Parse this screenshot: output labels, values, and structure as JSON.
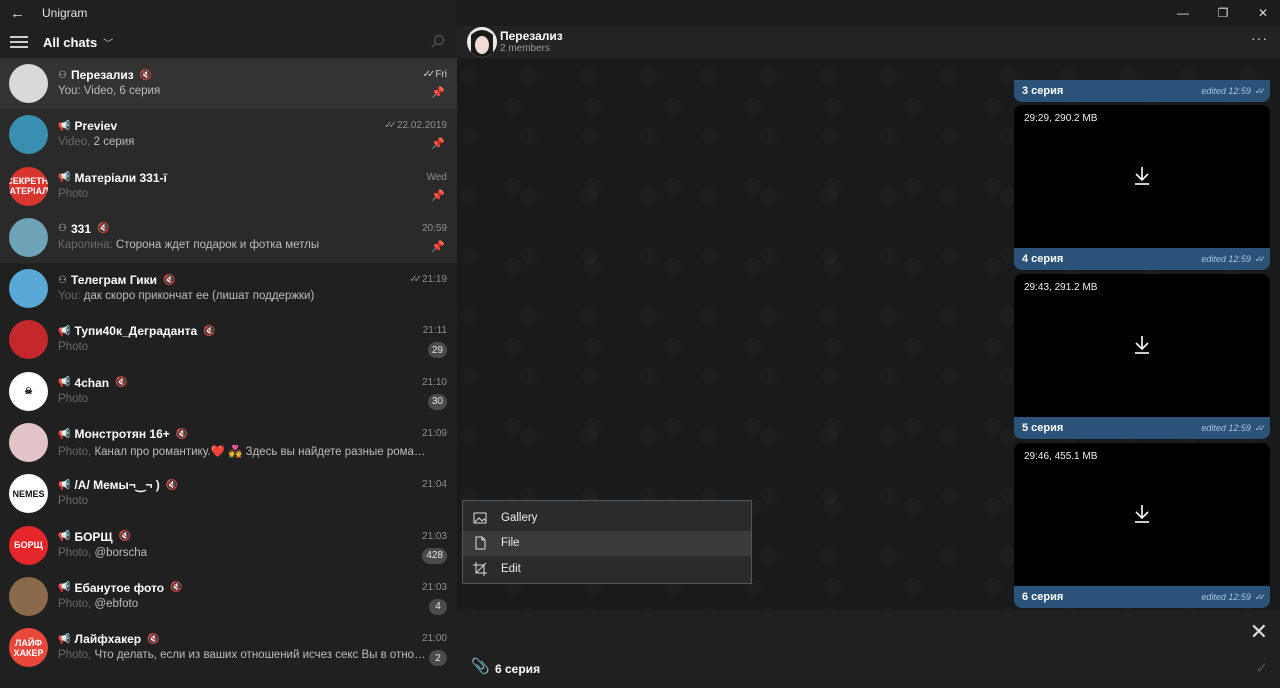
{
  "app": {
    "title": "Unigram"
  },
  "left": {
    "filter_label": "All chats",
    "chats": [
      {
        "name": "Перезализ",
        "preview_prefix": "",
        "preview": "You: Video, 6 серия",
        "time": "Fri",
        "read": true,
        "pinned": true,
        "muted": true,
        "type": "group",
        "badge": "",
        "avatar_color": "#d9d9d9",
        "avatar_text": ""
      },
      {
        "name": "Previev",
        "preview_prefix": "Video, ",
        "preview": "2 серия",
        "time": "22.02.2019",
        "read": true,
        "pinned": true,
        "muted": false,
        "type": "channel",
        "badge": "",
        "avatar_color": "#3a8fb0",
        "avatar_text": ""
      },
      {
        "name": "Матеріали 331-ї",
        "preview_prefix": "Photo",
        "preview": "",
        "time": "Wed",
        "read": false,
        "pinned": true,
        "muted": false,
        "type": "channel",
        "badge": "",
        "avatar_color": "#d8352f",
        "avatar_text": "СЕКРЕТНІ МАТЕРІАЛИ"
      },
      {
        "name": "331",
        "preview_prefix": "Каролина: ",
        "preview": "Сторона ждет подарок и фотка метлы",
        "time": "20:59",
        "read": false,
        "pinned": true,
        "muted": true,
        "type": "group",
        "badge": "",
        "avatar_color": "#6fa3b8",
        "avatar_text": ""
      },
      {
        "name": "Телеграм Гики",
        "preview_prefix": "You: ",
        "preview": "дак скоро прикончат ее (лишат поддержки)",
        "time": "21:19",
        "read": true,
        "pinned": false,
        "muted": true,
        "type": "group",
        "badge": "",
        "avatar_color": "#5aa8d6",
        "avatar_text": ""
      },
      {
        "name": "Тупи40к_Деграданта",
        "preview_prefix": "Photo",
        "preview": "",
        "time": "21:11",
        "read": false,
        "pinned": false,
        "muted": true,
        "type": "channel",
        "badge": "29",
        "avatar_color": "#c4282c",
        "avatar_text": ""
      },
      {
        "name": "4chan",
        "preview_prefix": "Photo",
        "preview": "",
        "time": "21:10",
        "read": false,
        "pinned": false,
        "muted": true,
        "type": "channel",
        "badge": "30",
        "avatar_color": "#ffffff",
        "avatar_text": "☠"
      },
      {
        "name": "Монстротян 16+",
        "preview_prefix": "Photo, ",
        "preview": "Канал про романтику.❤️ 💑 Здесь вы найдете разные романтичес...",
        "time": "21:09",
        "read": false,
        "pinned": false,
        "muted": true,
        "type": "channel",
        "badge": "",
        "avatar_color": "#e2c4c8",
        "avatar_text": ""
      },
      {
        "name": "/A/ Мемы¬‿¬ )",
        "preview_prefix": "Photo",
        "preview": "",
        "time": "21:04",
        "read": false,
        "pinned": false,
        "muted": true,
        "type": "channel",
        "badge": "",
        "avatar_color": "#ffffff",
        "avatar_text": "NEMES"
      },
      {
        "name": "БОРЩ",
        "preview_prefix": "Photo, ",
        "preview": "@borscha",
        "time": "21:03",
        "read": false,
        "pinned": false,
        "muted": true,
        "type": "channel",
        "badge": "428",
        "avatar_color": "#e5262a",
        "avatar_text": "БОРЩ"
      },
      {
        "name": "Ебанутое фото",
        "preview_prefix": "Photo, ",
        "preview": "@ebfoto",
        "time": "21:03",
        "read": false,
        "pinned": false,
        "muted": true,
        "type": "channel",
        "badge": "4",
        "avatar_color": "#8a6a4a",
        "avatar_text": ""
      },
      {
        "name": "Лайфхакер",
        "preview_prefix": "Photo, ",
        "preview": "Что делать, если из ваших отношений исчез секс  Вы в отноше...",
        "time": "21:00",
        "read": false,
        "pinned": false,
        "muted": true,
        "type": "channel",
        "badge": "2",
        "avatar_color": "#e8483c",
        "avatar_text": "ЛАЙФ ХАКЕР"
      }
    ]
  },
  "right": {
    "chat_title": "Перезализ",
    "chat_subtitle": "2 members",
    "videos": [
      {
        "caption": "3 серия",
        "info": "",
        "edited": "edited",
        "time": "12:59"
      },
      {
        "caption": "4 серия",
        "info": "29:29, 290.2 MB",
        "edited": "edited",
        "time": "12:59"
      },
      {
        "caption": "5 серия",
        "info": "29:43, 291.2 MB",
        "edited": "edited",
        "time": "12:59"
      },
      {
        "caption": "6 серия",
        "info": "29:46, 455.1 MB",
        "edited": "edited",
        "time": "12:59"
      }
    ],
    "menu": [
      {
        "label": "Gallery",
        "icon": "image-icon"
      },
      {
        "label": "File",
        "icon": "file-icon"
      },
      {
        "label": "Edit",
        "icon": "crop-icon"
      }
    ],
    "input_text": "6 серия"
  }
}
